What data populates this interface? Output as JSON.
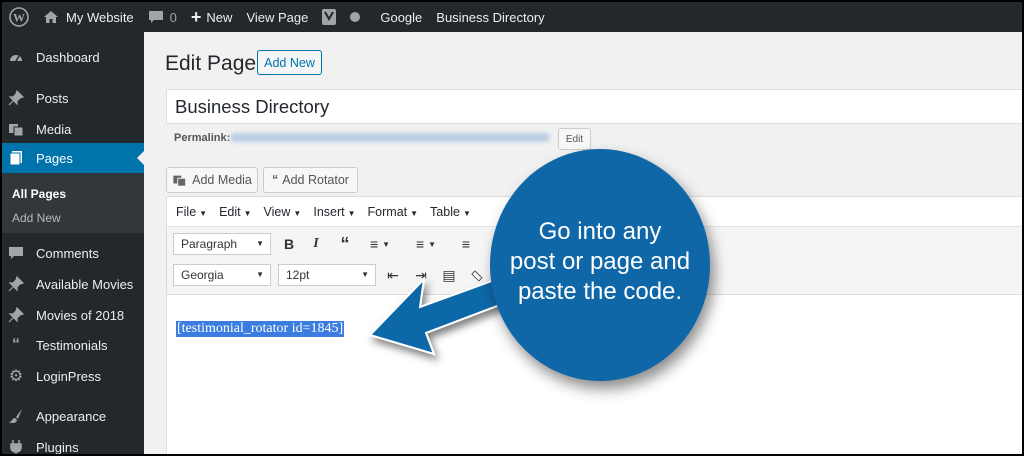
{
  "adminbar": {
    "site_name": "My Website",
    "comments_count": "0",
    "new_label": "New",
    "view_page_label": "View Page",
    "google_label": "Google",
    "business_directory_label": "Business Directory"
  },
  "sidebar": {
    "items": [
      {
        "label": "Dashboard",
        "icon": "dashboard-icon"
      },
      {
        "label": "Posts",
        "icon": "pin-icon"
      },
      {
        "label": "Media",
        "icon": "media-icon"
      },
      {
        "label": "Pages",
        "icon": "pages-icon"
      },
      {
        "label": "Comments",
        "icon": "comment-icon"
      },
      {
        "label": "Available Movies",
        "icon": "pin-icon"
      },
      {
        "label": "Movies of 2018",
        "icon": "pin-icon"
      },
      {
        "label": "Testimonials",
        "icon": "quote-icon"
      },
      {
        "label": "LoginPress",
        "icon": "gear-icon"
      },
      {
        "label": "Appearance",
        "icon": "brush-icon"
      },
      {
        "label": "Plugins",
        "icon": "plug-icon"
      }
    ],
    "submenu": [
      "All Pages",
      "Add New"
    ]
  },
  "main": {
    "page_title": "Edit Page",
    "add_new_label": "Add New",
    "title_value": "Business Directory",
    "permalink_label": "Permalink:",
    "edit_label": "Edit",
    "add_media_label": "Add Media",
    "add_rotator_label": "Add Rotator"
  },
  "editor": {
    "menus": [
      "File",
      "Edit",
      "View",
      "Insert",
      "Format",
      "Table"
    ],
    "paragraph_select": "Paragraph",
    "font_select": "Georgia",
    "size_select": "12pt",
    "shortcode": "[testimonial_rotator id=1845]"
  },
  "callout": {
    "lines": [
      "Go into any",
      "post or page and",
      "paste the code."
    ]
  },
  "colors": {
    "adminbar": "#23282d",
    "active": "#0073aa",
    "callout": "#0f67a8",
    "selection": "#3b7ce0"
  }
}
